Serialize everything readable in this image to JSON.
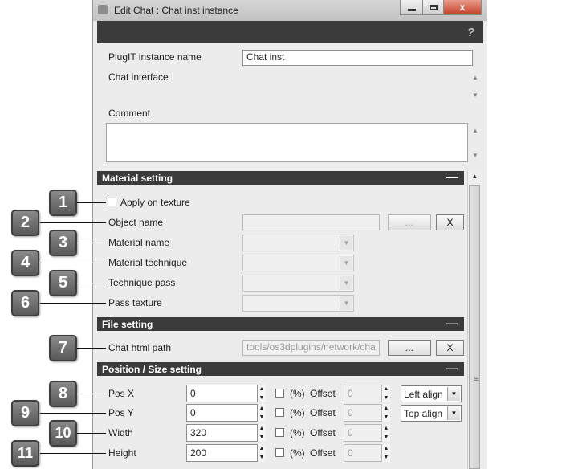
{
  "window": {
    "title": "Edit Chat : Chat inst instance",
    "close_glyph": "x",
    "help_glyph": "?"
  },
  "top": {
    "plugit_label": "PlugIT instance name",
    "plugit_value": "Chat inst",
    "chat_interface_label": "Chat interface",
    "comment_label": "Comment",
    "comment_value": ""
  },
  "material": {
    "header": "Material setting",
    "collapse_glyph": "—",
    "apply_on_texture_label": "Apply on texture",
    "object_name_label": "Object name",
    "object_name_value": "",
    "browse_label": "...",
    "clear_label": "X",
    "material_name_label": "Material name",
    "material_technique_label": "Material technique",
    "technique_pass_label": "Technique pass",
    "pass_texture_label": "Pass texture"
  },
  "file": {
    "header": "File setting",
    "collapse_glyph": "—",
    "html_path_label": "Chat html path",
    "html_path_value": "tools/os3dplugins/network/cha",
    "browse_label": "...",
    "clear_label": "X"
  },
  "position": {
    "header": "Position / Size setting",
    "collapse_glyph": "—",
    "percent_label": "(%)",
    "offset_label": "Offset",
    "rows": [
      {
        "label": "Pos X",
        "value": "0",
        "offset": "0"
      },
      {
        "label": "Pos Y",
        "value": "0",
        "offset": "0"
      },
      {
        "label": "Width",
        "value": "320",
        "offset": "0"
      },
      {
        "label": "Height",
        "value": "200",
        "offset": "0"
      }
    ],
    "horizontal_align": "Left align",
    "vertical_align": "Top align"
  },
  "badges": [
    "1",
    "2",
    "3",
    "4",
    "5",
    "6",
    "7",
    "8",
    "9",
    "10",
    "11"
  ],
  "colors": {
    "section_bar": "#3b3b3b",
    "badge_fill": "#6f6f6f",
    "window_bg": "#ececec"
  }
}
